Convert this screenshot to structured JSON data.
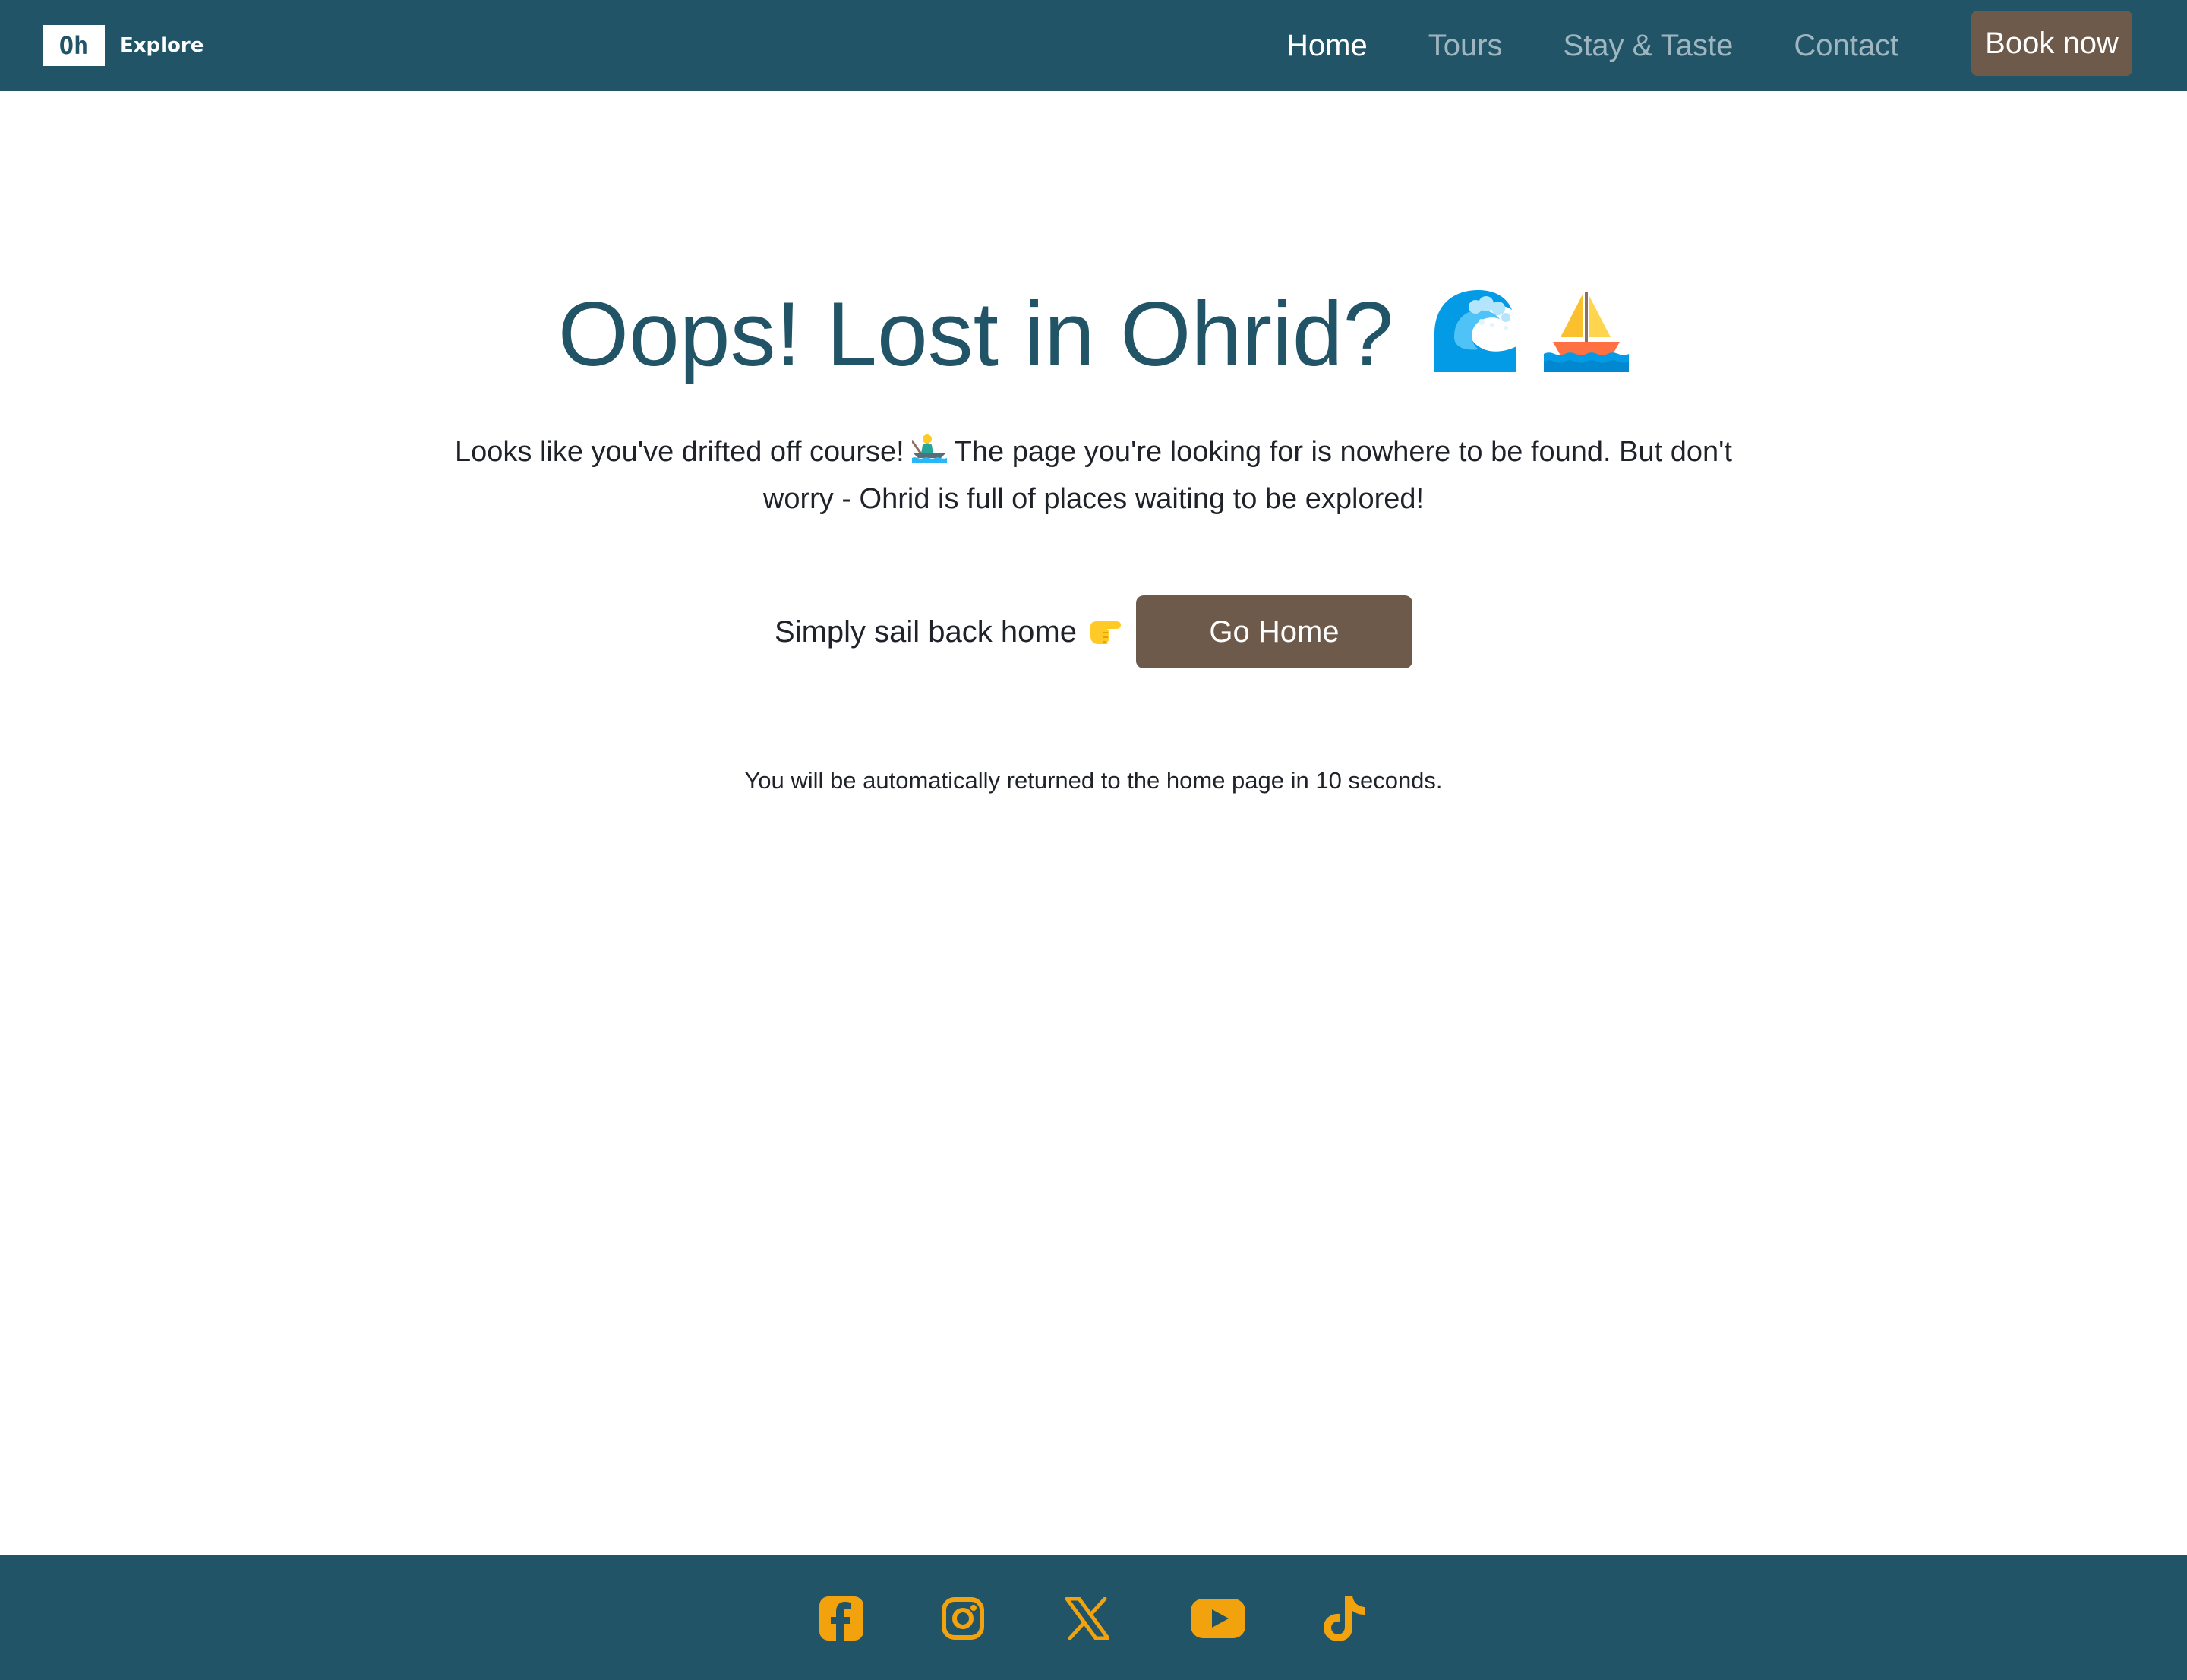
{
  "header": {
    "logo_mark": "Oh",
    "logo_text": "Explore",
    "nav": [
      {
        "label": "Home",
        "active": true
      },
      {
        "label": "Tours",
        "active": false
      },
      {
        "label": "Stay & Taste",
        "active": false
      },
      {
        "label": "Contact",
        "active": false
      }
    ],
    "book_label": "Book now"
  },
  "main": {
    "title": "Oops! Lost in Ohrid?",
    "title_emojis": [
      "water-wave",
      "sailboat"
    ],
    "description_part1": "Looks like you've drifted off course!",
    "description_emoji": "person-rowing-boat",
    "description_part2": "The page you're looking for is nowhere to be found. But don't worry - Ohrid is full of places waiting to be explored!",
    "cta_text": "Simply sail back home",
    "cta_emoji": "backhand-index-pointing-right",
    "go_home_label": "Go Home",
    "redirect_note": "You will be automatically returned to the home page in 10 seconds."
  },
  "footer": {
    "socials": [
      "facebook-icon",
      "instagram-icon",
      "x-icon",
      "youtube-icon",
      "tiktok-icon"
    ]
  },
  "colors": {
    "primary": "#215467",
    "accent_brown": "#6d5a4a",
    "social_icon": "#f2a20c",
    "nav_inactive": "#9fb6c0"
  }
}
